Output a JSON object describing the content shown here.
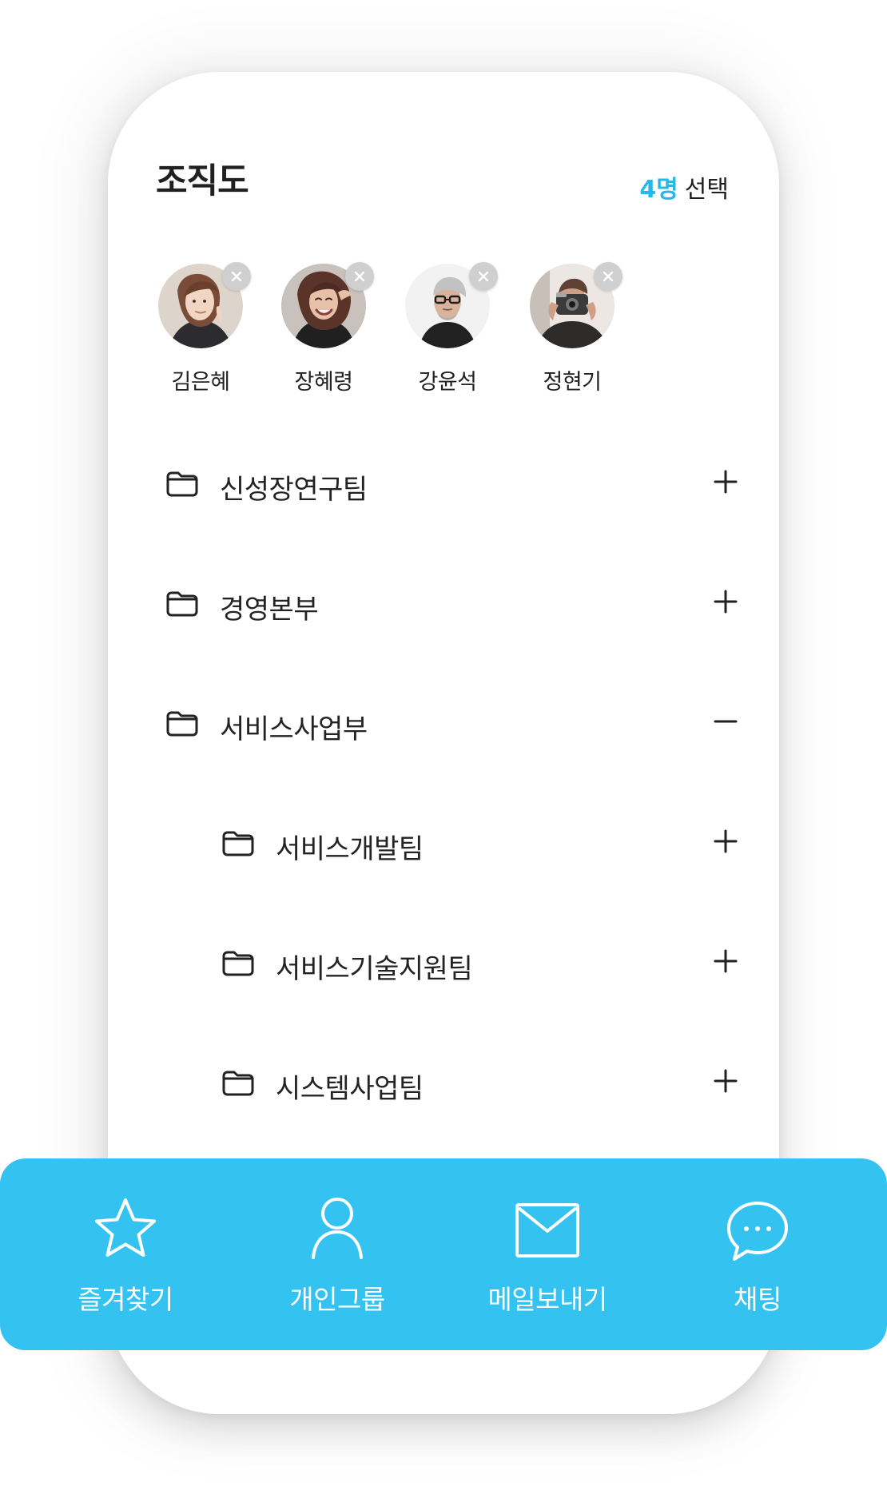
{
  "header": {
    "title": "조직도",
    "selected_count": "4명",
    "selected_label": "선택"
  },
  "selected_users": [
    {
      "name": "김은혜"
    },
    {
      "name": "장혜령"
    },
    {
      "name": "강윤석"
    },
    {
      "name": "정현기"
    }
  ],
  "org_tree": [
    {
      "label": "신성장연구팀",
      "toggle": "plus-icon"
    },
    {
      "label": "경영본부",
      "toggle": "plus-icon"
    },
    {
      "label": "서비스사업부",
      "toggle": "minus-icon"
    },
    {
      "label": "서비스개발팀",
      "toggle": "plus-icon"
    },
    {
      "label": "서비스기술지원팀",
      "toggle": "plus-icon"
    },
    {
      "label": "시스템사업팀",
      "toggle": "plus-icon"
    }
  ],
  "bottom_nav": [
    {
      "label": "즐겨찾기",
      "icon": "star-icon"
    },
    {
      "label": "개인그룹",
      "icon": "person-icon"
    },
    {
      "label": "메일보내기",
      "icon": "mail-icon"
    },
    {
      "label": "채팅",
      "icon": "chat-icon"
    }
  ],
  "colors": {
    "accent": "#34c3f1",
    "count": "#27b8ea",
    "text": "#222222",
    "remove_badge": "#cfcfcf"
  }
}
